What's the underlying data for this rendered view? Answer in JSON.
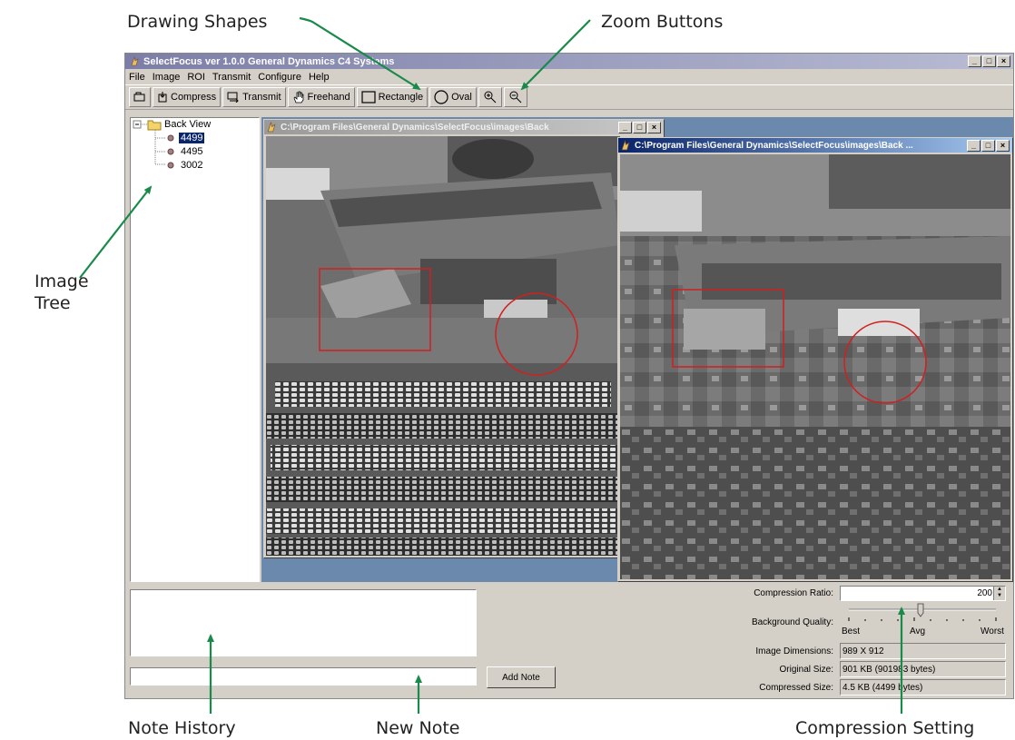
{
  "callouts": {
    "drawing_shapes": "Drawing Shapes",
    "zoom_buttons": "Zoom Buttons",
    "image_tree_line1": "Image",
    "image_tree_line2": "Tree",
    "note_history": "Note History",
    "new_note": "New Note",
    "compression_setting": "Compression Setting"
  },
  "app": {
    "title": "SelectFocus ver 1.0.0  General Dynamics C4 Systems",
    "menu": [
      "File",
      "Image",
      "ROI",
      "Transmit",
      "Configure",
      "Help"
    ],
    "toolbar": {
      "compress": "Compress",
      "transmit": "Transmit",
      "freehand": "Freehand",
      "rectangle": "Rectangle",
      "oval": "Oval"
    }
  },
  "tree": {
    "root": "Back View",
    "items": [
      "4499",
      "4495",
      "3002"
    ],
    "selected_index": 0
  },
  "windows": {
    "original_title": "C:\\Program Files\\General Dynamics\\SelectFocus\\images\\Back",
    "compressed_title": "C:\\Program Files\\General Dynamics\\SelectFocus\\images\\Back ..."
  },
  "notes": {
    "history": "",
    "new_note_value": "",
    "add_note_label": "Add Note"
  },
  "compression": {
    "ratio_label": "Compression Ratio:",
    "ratio_value": "200",
    "quality_label": "Background Quality:",
    "slider_best": "Best",
    "slider_avg": "Avg",
    "slider_worst": "Worst",
    "dimensions_label": "Image Dimensions:",
    "dimensions_value": "989 X 912",
    "original_label": "Original Size:",
    "original_value": "901 KB  (901983 bytes)",
    "compressed_label": "Compressed Size:",
    "compressed_value": "4.5 KB  (4499 bytes)"
  },
  "colors": {
    "callout_arrow": "#1a8a4a",
    "roi_outline": "#d02020",
    "mdi_background": "#6b88ad",
    "selection": "#0a246a"
  }
}
